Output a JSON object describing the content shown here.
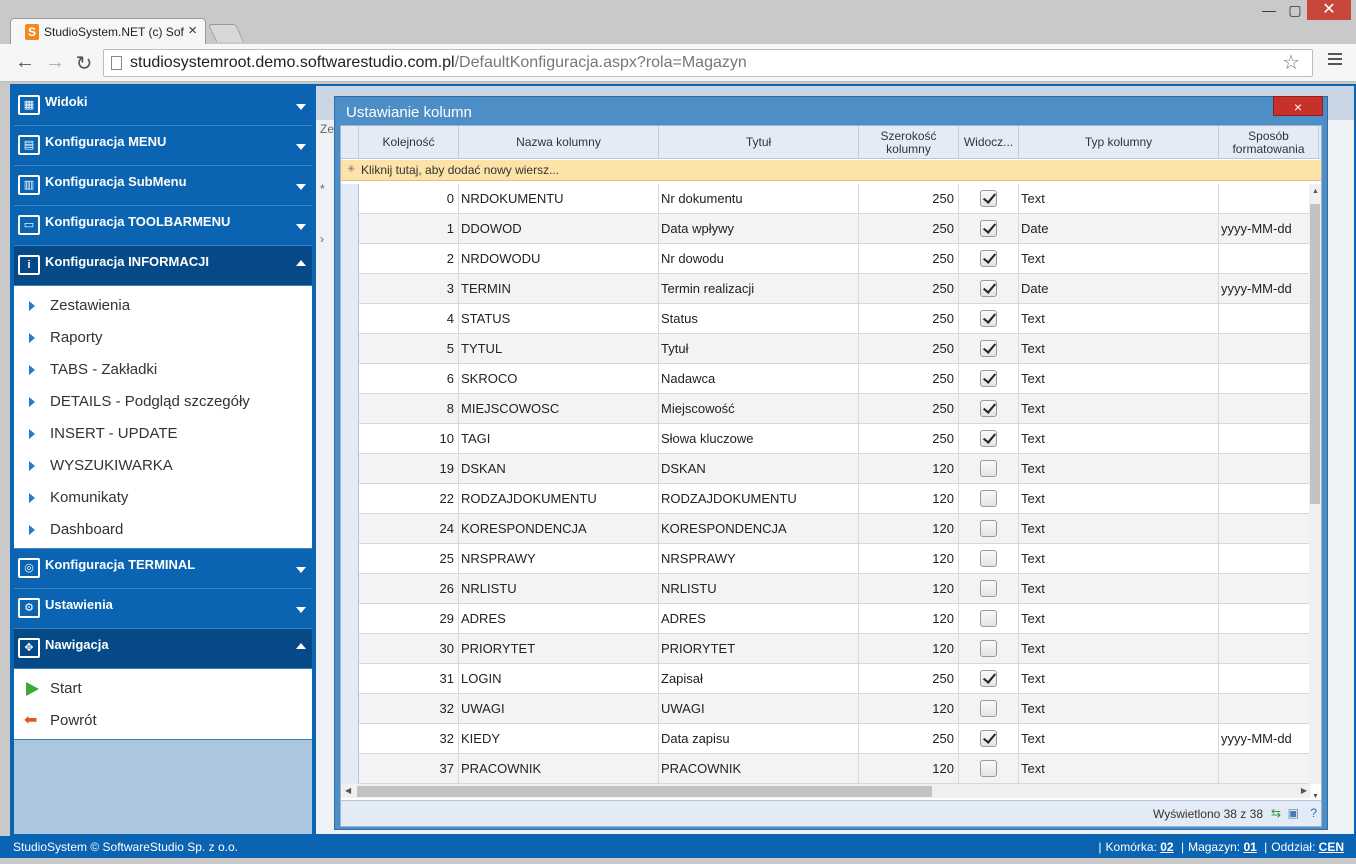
{
  "browser": {
    "tab_title": "StudioSystem.NET (c) Soft",
    "tab_close": "×",
    "favicon": "S",
    "url_host": "studiosystemroot.demo.softwarestudio.com.pl",
    "url_path": "/DefaultKonfiguracja.aspx?rola=Magazyn",
    "back_icon": "←",
    "forward_icon": "→",
    "reload_icon": "↻",
    "star_icon": "☆",
    "win_min": "—",
    "win_max": "▢",
    "win_close": "✕"
  },
  "sidebar": {
    "sections": [
      {
        "label": "Widoki",
        "icon": "table-icon",
        "expanded": false
      },
      {
        "label": "Konfiguracja MENU",
        "icon": "menu-config-icon",
        "expanded": false
      },
      {
        "label": "Konfiguracja SubMenu",
        "icon": "submenu-icon",
        "expanded": false
      },
      {
        "label": "Konfiguracja TOOLBARMENU",
        "icon": "toolbar-icon",
        "expanded": false
      },
      {
        "label": "Konfiguracja INFORMACJI",
        "icon": "info-icon",
        "expanded": true
      },
      {
        "label": "Konfiguracja TERMINAL",
        "icon": "terminal-icon",
        "expanded": false
      },
      {
        "label": "Ustawienia",
        "icon": "gear-icon",
        "expanded": false
      },
      {
        "label": "Nawigacja",
        "icon": "navigation-icon",
        "expanded": true
      }
    ],
    "info_items": [
      "Zestawienia",
      "Raporty",
      "TABS - Zakładki",
      "DETAILS - Podgląd szczegóły",
      "INSERT - UPDATE",
      "WYSZUKIWARKA",
      "Komunikaty",
      "Dashboard"
    ],
    "nav_items": [
      "Start",
      "Powrót"
    ]
  },
  "modal": {
    "title": "Ustawianie kolumn",
    "close": "×",
    "columns": [
      "Kolejność",
      "Nazwa kolumny",
      "Tytuł",
      "Szerokość kolumny",
      "Widocz...",
      "Typ kolumny",
      "Sposób formatowania"
    ],
    "new_row_text": "Kliknij tutaj, aby dodać nowy wiersz...",
    "rows": [
      {
        "order": "0",
        "name": "NRDOKUMENTU",
        "title": "Nr dokumentu",
        "width": "250",
        "visible": true,
        "type": "Text",
        "format": ""
      },
      {
        "order": "1",
        "name": "DDOWOD",
        "title": "Data wpływy",
        "width": "250",
        "visible": true,
        "type": "Date",
        "format": "yyyy-MM-dd"
      },
      {
        "order": "2",
        "name": "NRDOWODU",
        "title": "Nr dowodu",
        "width": "250",
        "visible": true,
        "type": "Text",
        "format": ""
      },
      {
        "order": "3",
        "name": "TERMIN",
        "title": "Termin realizacji",
        "width": "250",
        "visible": true,
        "type": "Date",
        "format": "yyyy-MM-dd"
      },
      {
        "order": "4",
        "name": "STATUS",
        "title": "Status",
        "width": "250",
        "visible": true,
        "type": "Text",
        "format": ""
      },
      {
        "order": "5",
        "name": "TYTUL",
        "title": "Tytuł",
        "width": "250",
        "visible": true,
        "type": "Text",
        "format": ""
      },
      {
        "order": "6",
        "name": "SKROCO",
        "title": "Nadawca",
        "width": "250",
        "visible": true,
        "type": "Text",
        "format": ""
      },
      {
        "order": "8",
        "name": "MIEJSCOWOSC",
        "title": "Miejscowość",
        "width": "250",
        "visible": true,
        "type": "Text",
        "format": ""
      },
      {
        "order": "10",
        "name": "TAGI",
        "title": "Słowa kluczowe",
        "width": "250",
        "visible": true,
        "type": "Text",
        "format": ""
      },
      {
        "order": "19",
        "name": "DSKAN",
        "title": "DSKAN",
        "width": "120",
        "visible": false,
        "type": "Text",
        "format": ""
      },
      {
        "order": "22",
        "name": "RODZAJDOKUMENTU",
        "title": "RODZAJDOKUMENTU",
        "width": "120",
        "visible": false,
        "type": "Text",
        "format": ""
      },
      {
        "order": "24",
        "name": "KORESPONDENCJA",
        "title": "KORESPONDENCJA",
        "width": "120",
        "visible": false,
        "type": "Text",
        "format": ""
      },
      {
        "order": "25",
        "name": "NRSPRAWY",
        "title": "NRSPRAWY",
        "width": "120",
        "visible": false,
        "type": "Text",
        "format": ""
      },
      {
        "order": "26",
        "name": "NRLISTU",
        "title": "NRLISTU",
        "width": "120",
        "visible": false,
        "type": "Text",
        "format": ""
      },
      {
        "order": "29",
        "name": "ADRES",
        "title": "ADRES",
        "width": "120",
        "visible": false,
        "type": "Text",
        "format": ""
      },
      {
        "order": "30",
        "name": "PRIORYTET",
        "title": "PRIORYTET",
        "width": "120",
        "visible": false,
        "type": "Text",
        "format": ""
      },
      {
        "order": "31",
        "name": "LOGIN",
        "title": "Zapisał",
        "width": "250",
        "visible": true,
        "type": "Text",
        "format": ""
      },
      {
        "order": "32",
        "name": "UWAGI",
        "title": "UWAGI",
        "width": "120",
        "visible": false,
        "type": "Text",
        "format": ""
      },
      {
        "order": "32",
        "name": "KIEDY",
        "title": "Data zapisu",
        "width": "250",
        "visible": true,
        "type": "Text",
        "format": "yyyy-MM-dd"
      },
      {
        "order": "37",
        "name": "PRACOWNIK",
        "title": "PRACOWNIK",
        "width": "120",
        "visible": false,
        "type": "Text",
        "format": ""
      }
    ],
    "footer_count": "Wyświetlono 38 z 38"
  },
  "statusbar": {
    "copyright": "StudioSystem © SoftwareStudio Sp. z o.o.",
    "komorka_label": "Komórka:",
    "komorka_value": "02",
    "magazyn_label": "Magazyn:",
    "magazyn_value": "01",
    "oddzial_label": "Oddział:",
    "oddzial_value": "CEN"
  },
  "background": {
    "partial_label": "Ze"
  },
  "colors": {
    "app_blue": "#0b64b1",
    "section_open": "#054a86",
    "new_row": "#fde3a7",
    "close_red": "#c8302a"
  }
}
